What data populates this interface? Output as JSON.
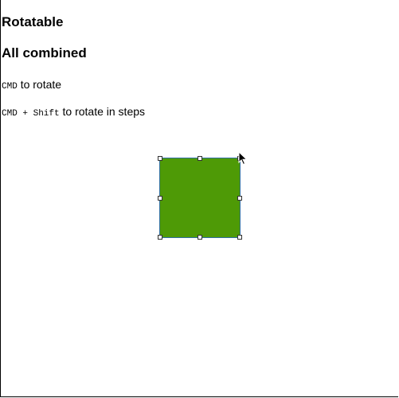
{
  "page": {
    "title": "Rotatable",
    "subtitle": "All combined",
    "hints": [
      {
        "key": "CMD",
        "text": " to rotate"
      },
      {
        "key": "CMD + Shift",
        "text": " to rotate in steps"
      }
    ]
  },
  "element": {
    "fill_color": "#4e9a06",
    "handles": [
      "top-left",
      "top-middle",
      "top-right",
      "middle-left",
      "middle-right",
      "bottom-left",
      "bottom-middle",
      "bottom-right"
    ]
  },
  "cursor": {
    "icon": "arrow-cursor-icon"
  }
}
